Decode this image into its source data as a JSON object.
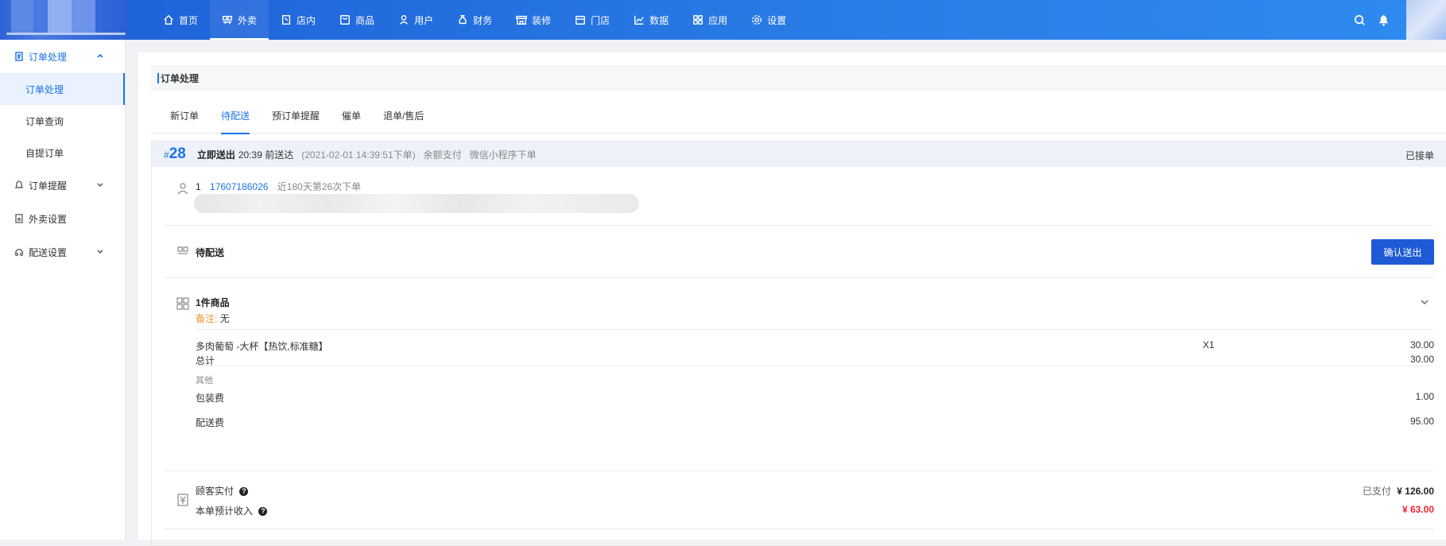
{
  "topnav": {
    "items": [
      {
        "label": "首页",
        "icon": "home-icon"
      },
      {
        "label": "外卖",
        "icon": "takeout-icon"
      },
      {
        "label": "店内",
        "icon": "dine-in-icon"
      },
      {
        "label": "商品",
        "icon": "goods-icon"
      },
      {
        "label": "用户",
        "icon": "user-icon"
      },
      {
        "label": "财务",
        "icon": "money-bag-icon"
      },
      {
        "label": "装修",
        "icon": "storefront-icon"
      },
      {
        "label": "门店",
        "icon": "store-icon"
      },
      {
        "label": "数据",
        "icon": "chart-icon"
      },
      {
        "label": "应用",
        "icon": "apps-grid-icon"
      },
      {
        "label": "设置",
        "icon": "gear-icon"
      }
    ],
    "active": "外卖"
  },
  "sidebar": {
    "groups": [
      {
        "label": "订单处理",
        "open": true,
        "subitems": [
          "订单处理",
          "订单查询",
          "自提订单"
        ],
        "active_sub": "订单处理"
      },
      {
        "label": "订单提醒",
        "open": false
      },
      {
        "label": "外卖设置"
      },
      {
        "label": "配送设置",
        "open": false
      }
    ]
  },
  "page": {
    "title": "订单处理"
  },
  "tabs": [
    "新订单",
    "待配送",
    "预订单提醒",
    "催单",
    "退单/售后"
  ],
  "active_tab": "待配送",
  "order": {
    "hash": "#",
    "number": "28",
    "delivery_type": "立即送出",
    "eta": "20:39 前送达",
    "placed_at": "(2021-02-01 14:39:51下单)",
    "payment": "余额支付",
    "source": "微信小程序下单",
    "status": "已接单",
    "customer": {
      "name": "1",
      "phone": "17607186026",
      "history": "近180天第26次下单"
    },
    "delivery_status": "待配送",
    "confirm_button": "确认送出",
    "items_title": "1件商品",
    "remark_label": "备注:",
    "remark_value": "无",
    "items": [
      {
        "name": "多肉葡萄 -大杯【热饮,标准糖】",
        "qty": "X1",
        "price": "30.00"
      }
    ],
    "total_label": "总计",
    "total_value": "30.00",
    "other_label": "其他",
    "packaging_label": "包装费",
    "packaging_value": "1.00",
    "delivery_fee_label": "配送费",
    "delivery_fee_value": "95.00",
    "customer_paid_label": "顾客实付",
    "paid_status": "已支付",
    "paid_amount": "¥ 126.00",
    "expected_income_label": "本单预计收入",
    "expected_income": "¥ 63.00"
  },
  "colors": {
    "primary": "#1a73e8",
    "button": "#1e5ad6",
    "income": "#f5222d",
    "remark": "#f0932b"
  }
}
